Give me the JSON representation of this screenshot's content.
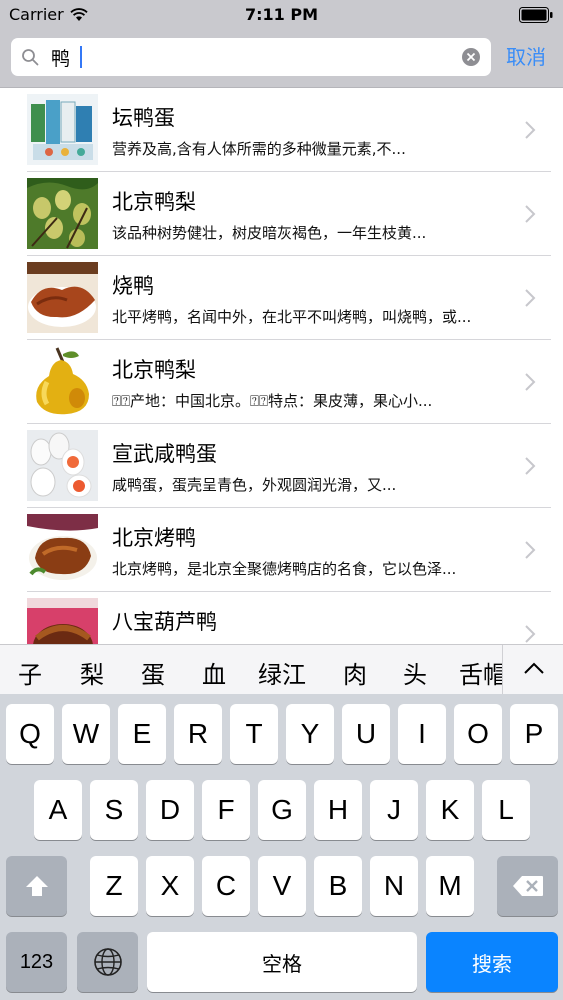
{
  "status_bar": {
    "carrier": "Carrier",
    "time": "7:11 PM"
  },
  "search": {
    "query": "鸭",
    "cancel_label": "取消"
  },
  "results": [
    {
      "title": "坛鸭蛋",
      "desc": "营养及高,含有人体所需的多种微量元素,不...",
      "thumb": "product-boxes"
    },
    {
      "title": "北京鸭梨",
      "desc": "该品种树势健壮，树皮暗灰褐色，一年生枝黄...",
      "thumb": "pears-on-tree"
    },
    {
      "title": "烧鸭",
      "desc": "北平烤鸭，名闻中外，在北平不叫烤鸭，叫烧鸭，或...",
      "thumb": "roast-duck"
    },
    {
      "title": "北京鸭梨",
      "desc": "⍰⍰产地：中国北京。⍰⍰特点：果皮薄，果心小...",
      "thumb": "single-pear"
    },
    {
      "title": "宣武咸鸭蛋",
      "desc": "咸鸭蛋，蛋壳呈青色，外观圆润光滑，又...",
      "thumb": "salted-eggs"
    },
    {
      "title": "北京烤鸭",
      "desc": "北京烤鸭，是北京全聚德烤鸭店的名食，它以色泽...",
      "thumb": "peking-duck"
    },
    {
      "title": "八宝葫芦鸭",
      "desc": "",
      "thumb": "eight-treasure-duck"
    }
  ],
  "suggestions": [
    "子",
    "梨",
    "蛋",
    "血",
    "绿江",
    "肉",
    "头",
    "舌帽"
  ],
  "keyboard": {
    "row1": [
      "Q",
      "W",
      "E",
      "R",
      "T",
      "Y",
      "U",
      "I",
      "O",
      "P"
    ],
    "row2": [
      "A",
      "S",
      "D",
      "F",
      "G",
      "H",
      "J",
      "K",
      "L"
    ],
    "row3": [
      "Z",
      "X",
      "C",
      "V",
      "B",
      "N",
      "M"
    ],
    "numbers_label": "123",
    "space_label": "空格",
    "return_label": "搜索",
    "shift_icon": "shift-arrow-icon",
    "delete_icon": "backspace-icon",
    "globe_icon": "globe-icon"
  },
  "colors": {
    "accent": "#3a8df7",
    "return_key": "#0a84ff",
    "keyboard_bg": "#d1d5db",
    "header_bg": "#c9c9ce"
  }
}
